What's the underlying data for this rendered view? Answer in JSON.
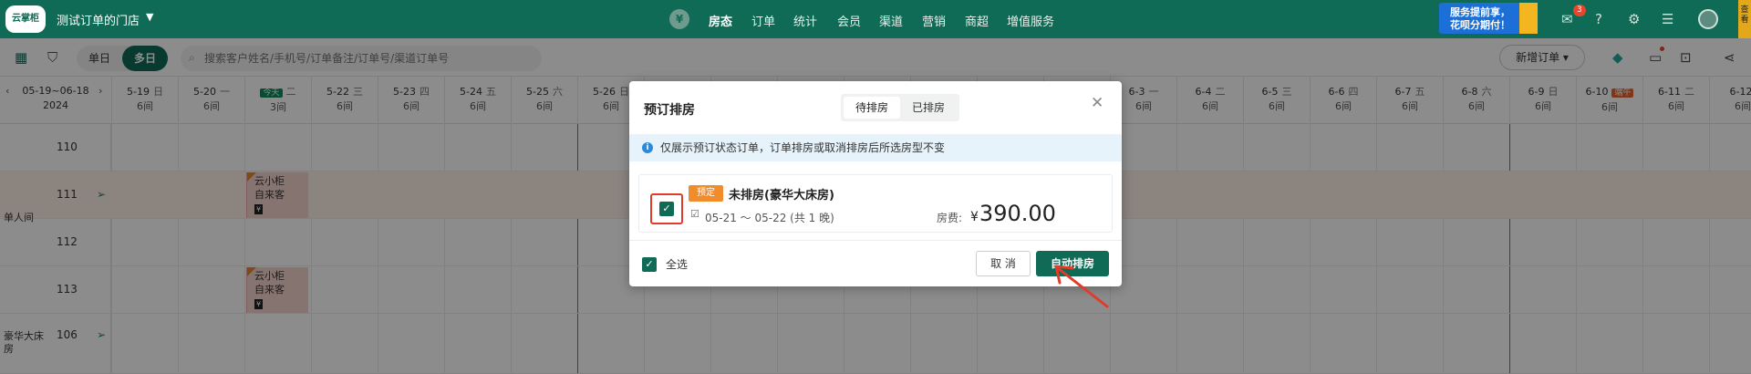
{
  "topbar": {
    "logo_text": "云掌柜",
    "store_name": "测试订单的门店",
    "nav": [
      "房态",
      "订单",
      "统计",
      "会员",
      "渠道",
      "营销",
      "商超",
      "增值服务"
    ],
    "nav_active": "房态",
    "banner_line1": "服务提前享，",
    "banner_line2": "花呗分期付！",
    "msg_badge": "3",
    "side_tab": "查看"
  },
  "toolbar": {
    "seg_single": "单日",
    "seg_multi": "多日",
    "search_placeholder": "搜索客户姓名/手机号/订单备注/订单号/渠道订单号",
    "new_order": "新增订单 ▾"
  },
  "calendar": {
    "range": "05-19~06-18",
    "year": "2024",
    "dates": [
      {
        "d": "5-19",
        "w": "日",
        "c": "6间"
      },
      {
        "d": "5-20",
        "w": "一",
        "c": "6间"
      },
      {
        "d": "今天",
        "w": "二",
        "c": "3间"
      },
      {
        "d": "5-22",
        "w": "三",
        "c": "6间"
      },
      {
        "d": "5-23",
        "w": "四",
        "c": "6间"
      },
      {
        "d": "5-24",
        "w": "五",
        "c": "6间"
      },
      {
        "d": "5-25",
        "w": "六",
        "c": "6间"
      },
      {
        "d": "5-26",
        "w": "日",
        "c": "6间"
      },
      {
        "d": "",
        "w": "",
        "c": ""
      },
      {
        "d": "",
        "w": "",
        "c": ""
      },
      {
        "d": "",
        "w": "",
        "c": ""
      },
      {
        "d": "",
        "w": "",
        "c": ""
      },
      {
        "d": "",
        "w": "",
        "c": ""
      },
      {
        "d": "",
        "w": "",
        "c": ""
      },
      {
        "d": "",
        "w": "",
        "c": ""
      },
      {
        "d": "6-3",
        "w": "一",
        "c": "6间"
      },
      {
        "d": "6-4",
        "w": "二",
        "c": "6间"
      },
      {
        "d": "6-5",
        "w": "三",
        "c": "6间"
      },
      {
        "d": "6-6",
        "w": "四",
        "c": "6间"
      },
      {
        "d": "6-7",
        "w": "五",
        "c": "6间"
      },
      {
        "d": "6-8",
        "w": "六",
        "c": "6间"
      },
      {
        "d": "6-9",
        "w": "日",
        "c": "6间"
      },
      {
        "d": "6-10",
        "w": "端午",
        "c": "6间"
      },
      {
        "d": "6-11",
        "w": "二",
        "c": "6间"
      },
      {
        "d": "6-12",
        "w": "",
        "c": "6间"
      }
    ],
    "room_types": [
      "单人间",
      "豪华大床房"
    ],
    "rooms": [
      "110",
      "111",
      "112",
      "113",
      "106"
    ],
    "booking_guest": "云小柜",
    "booking_note": "自来客",
    "booking_mark": "¥"
  },
  "modal": {
    "title": "预订排房",
    "tab_pending": "待排房",
    "tab_done": "已排房",
    "info": "仅展示预订状态订单，订单排房或取消排房后所选房型不变",
    "card_tag": "预定",
    "card_title": "未排房(豪华大床房)",
    "card_dates": "05-21 ～ 05-22 (共 1 晚)",
    "fee_label": "房费:",
    "currency": "¥",
    "fee_amount": "390.00",
    "select_all": "全选",
    "cancel": "取 消",
    "auto_assign": "自动排房"
  },
  "colors": {
    "brand": "#0f6b56",
    "highlight": "#e03b2b",
    "tag": "#f08c2c"
  }
}
